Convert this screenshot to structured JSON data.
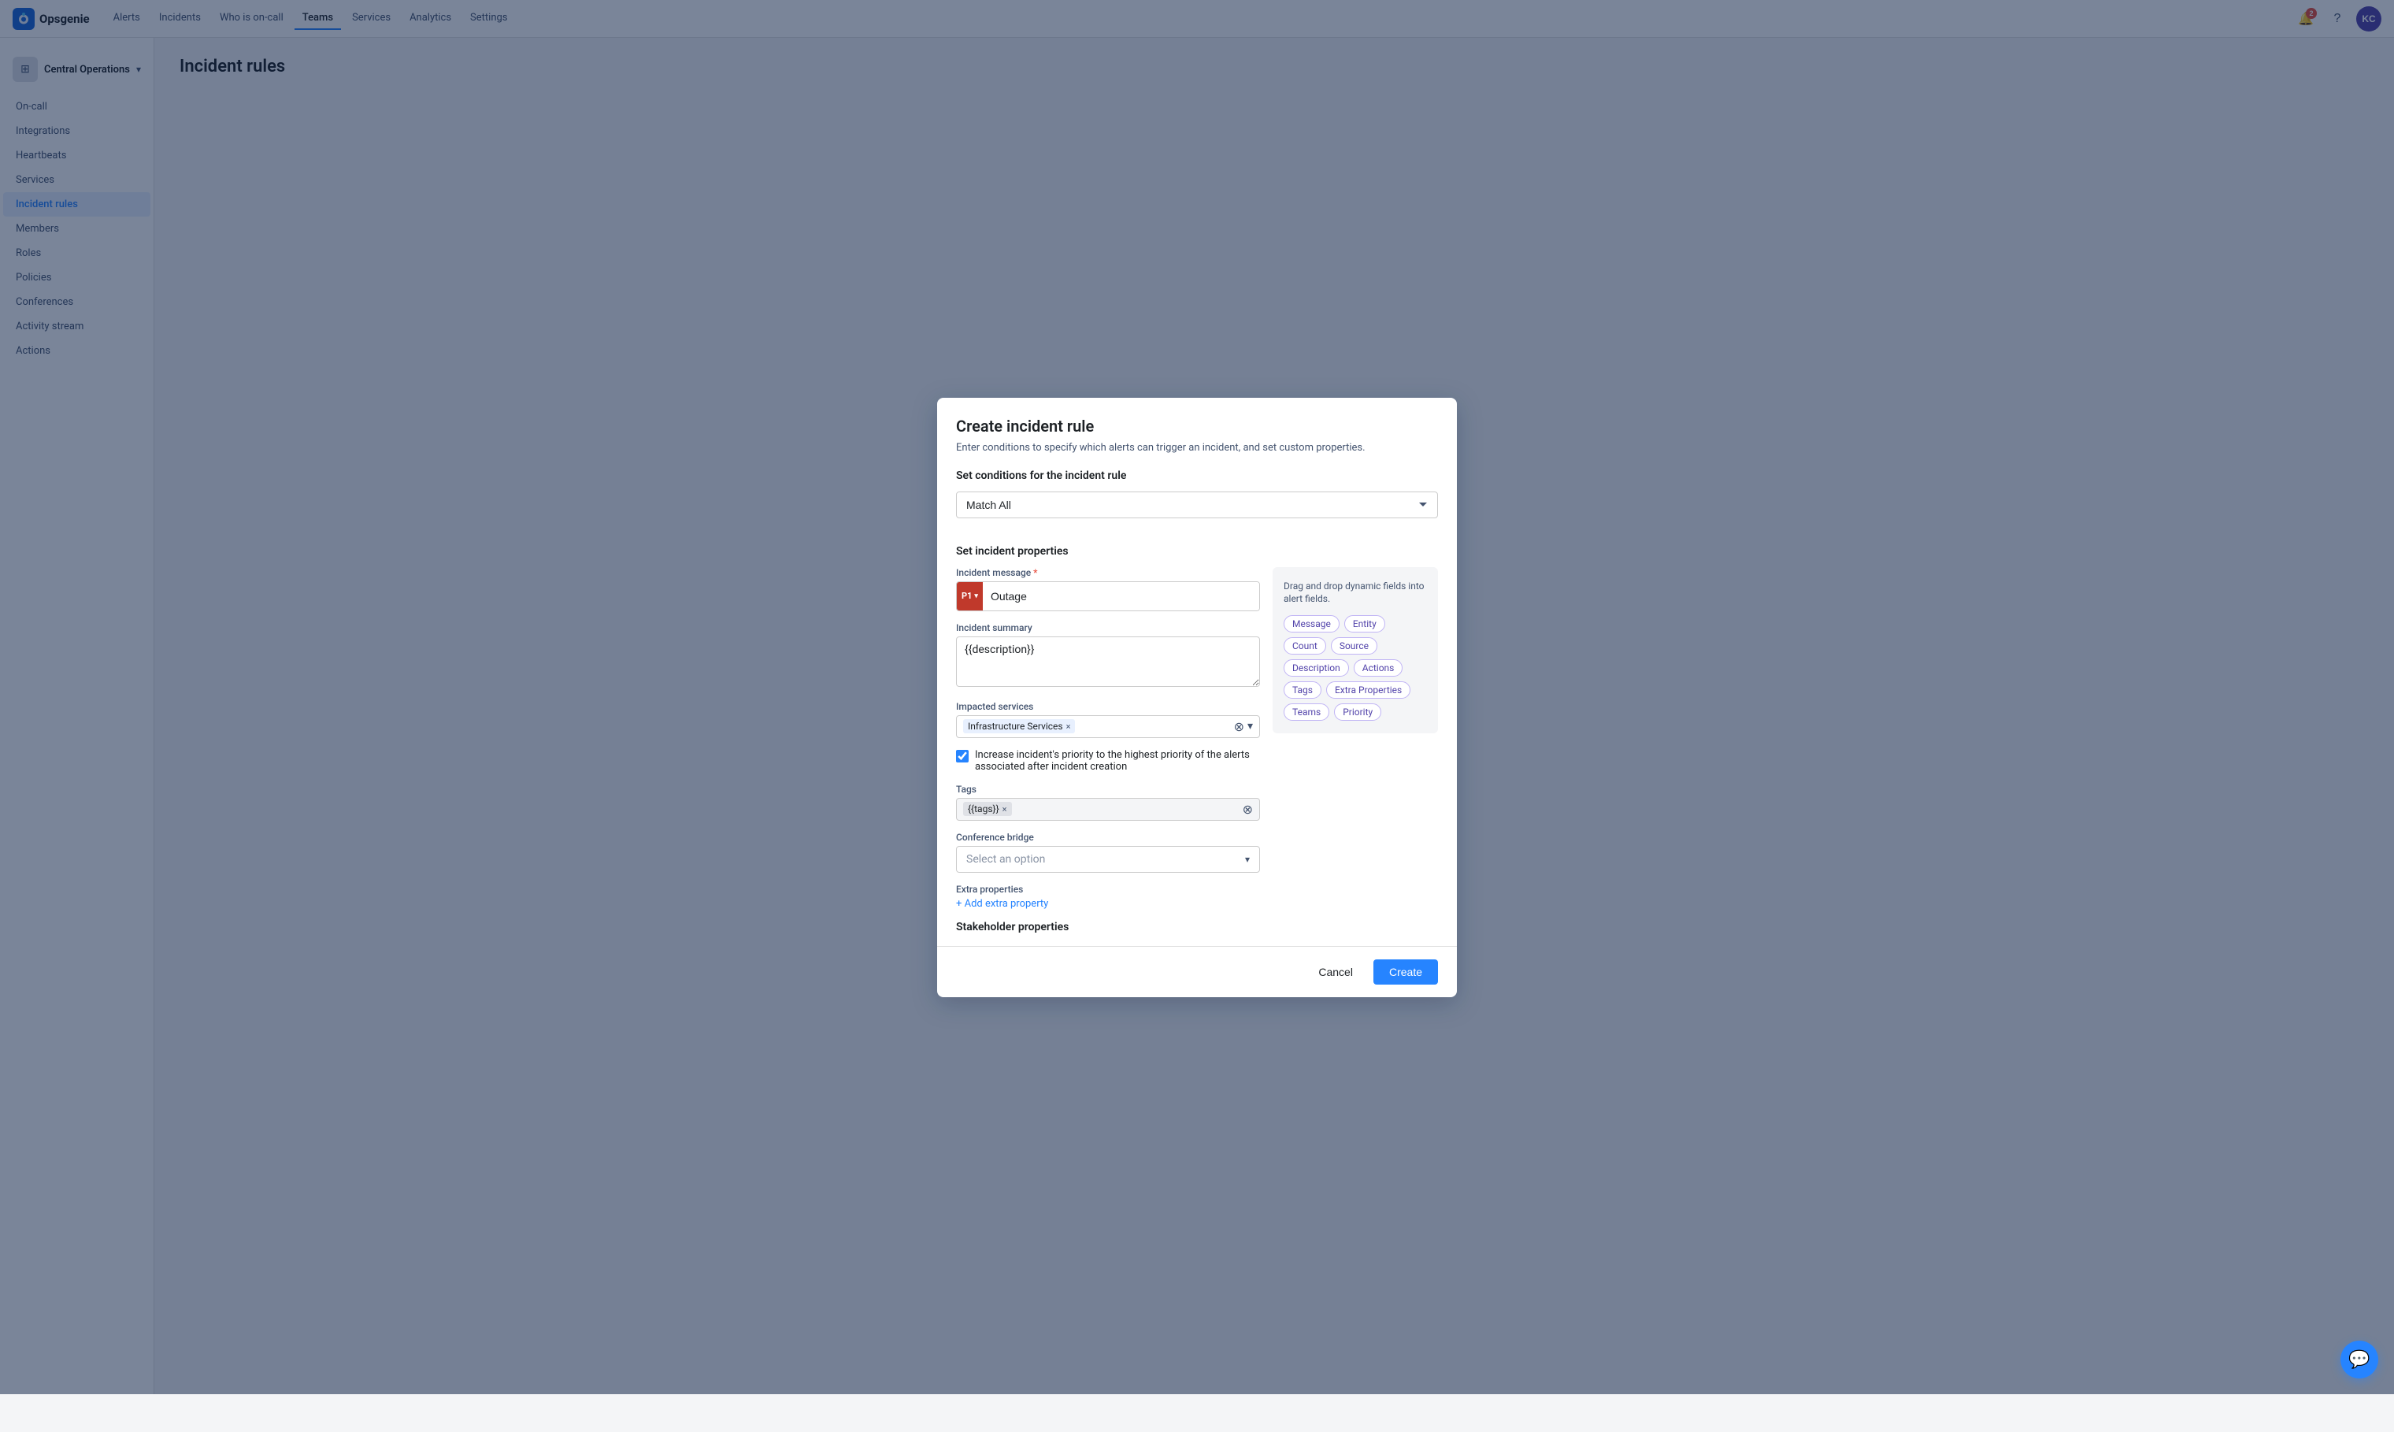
{
  "app": {
    "name": "Opsgenie",
    "logo_text": "Opsgenie"
  },
  "topnav": {
    "links": [
      {
        "label": "Alerts",
        "active": false
      },
      {
        "label": "Incidents",
        "active": false
      },
      {
        "label": "Who is on-call",
        "active": false
      },
      {
        "label": "Teams",
        "active": true
      },
      {
        "label": "Services",
        "active": false
      },
      {
        "label": "Analytics",
        "active": false
      },
      {
        "label": "Settings",
        "active": false
      }
    ],
    "notification_count": "2",
    "avatar_initials": "KC"
  },
  "sidebar": {
    "team_name": "Central Operations",
    "nav_items": [
      {
        "label": "On-call",
        "active": false
      },
      {
        "label": "Integrations",
        "active": false
      },
      {
        "label": "Heartbeats",
        "active": false
      },
      {
        "label": "Services",
        "active": false
      },
      {
        "label": "Incident rules",
        "active": true
      },
      {
        "label": "Members",
        "active": false
      },
      {
        "label": "Roles",
        "active": false
      },
      {
        "label": "Policies",
        "active": false
      },
      {
        "label": "Conferences",
        "active": false
      },
      {
        "label": "Activity stream",
        "active": false
      },
      {
        "label": "Actions",
        "active": false
      }
    ]
  },
  "main": {
    "page_title": "Incident rules"
  },
  "modal": {
    "title": "Create incident rule",
    "subtitle": "Enter conditions to specify which alerts can trigger an incident, and set custom properties.",
    "conditions_section_title": "Set conditions for the incident rule",
    "match_all_label": "Match All",
    "incident_props_section_title": "Set incident properties",
    "incident_message_label": "Incident message",
    "priority_badge": "P1",
    "incident_message_value": "Outage",
    "incident_summary_label": "Incident summary",
    "incident_summary_value": "{{description}}",
    "impacted_services_label": "Impacted services",
    "impacted_service_tag": "Infrastructure Services",
    "checkbox_label": "Increase incident's priority to the highest priority of the alerts associated after incident creation",
    "tags_label": "Tags",
    "tag_value": "{{tags}}",
    "conference_bridge_label": "Conference bridge",
    "conference_bridge_placeholder": "Select an option",
    "extra_props_label": "Extra properties",
    "add_extra_property_label": "+ Add extra property",
    "stakeholder_title": "Stakeholder properties",
    "dynamic_panel_title": "Drag and drop dynamic fields into alert fields.",
    "dynamic_chips": [
      "Message",
      "Entity",
      "Count",
      "Source",
      "Description",
      "Actions",
      "Tags",
      "Extra Properties",
      "Teams",
      "Priority"
    ],
    "cancel_label": "Cancel",
    "create_label": "Create"
  }
}
